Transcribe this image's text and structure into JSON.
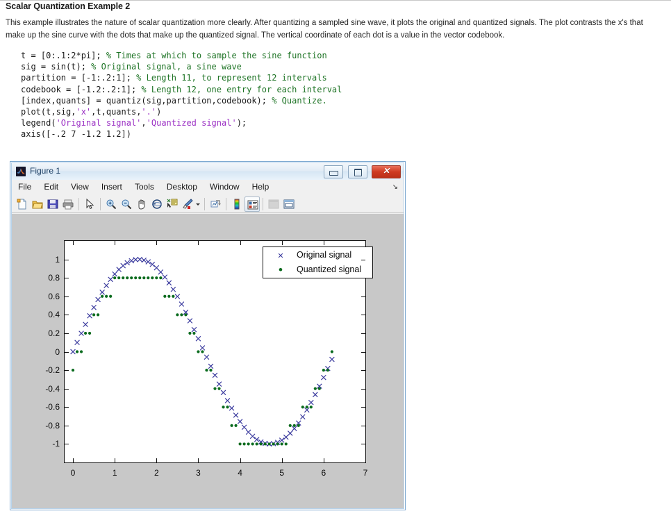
{
  "document": {
    "title": "Scalar Quantization Example 2",
    "paragraph": "This example illustrates the nature of scalar quantization more clearly. After quantizing a sampled sine wave, it plots the original and quantized signals. The plot contrasts the x's that make up the sine curve with the dots that make up the quantized signal. The vertical coordinate of each dot is a value in the vector codebook."
  },
  "code": {
    "lines": [
      {
        "code": "t = [0:.1:2*pi]; ",
        "comment": "% Times at which to sample the sine function"
      },
      {
        "code": "sig = sin(t); ",
        "comment": "% Original signal, a sine wave"
      },
      {
        "code": "partition = [-1:.2:1]; ",
        "comment": "% Length 11, to represent 12 intervals"
      },
      {
        "code": "codebook = [-1.2:.2:1]; ",
        "comment": "% Length 12, one entry for each interval"
      },
      {
        "code": "[index,quants] = quantiz(sig,partition,codebook); ",
        "comment": "% Quantize."
      },
      {
        "code": "plot(t,sig,",
        "str1": "'x'",
        "mid": ",t,quants,",
        "str2": "'.'",
        "tail": ")"
      },
      {
        "code": "legend(",
        "str1": "'Original signal'",
        "mid": ",",
        "str2": "'Quantized signal'",
        "tail": ");"
      },
      {
        "code": "axis([-.2 7 -1.2 1.2])",
        "comment": ""
      }
    ]
  },
  "figure_window": {
    "title": "Figure 1",
    "icon": "matlab-logo-icon",
    "window_controls": {
      "minimize": "minimize-button",
      "maximize": "maximize-button",
      "close": "close-button",
      "close_glyph": "✕"
    },
    "menu": [
      "File",
      "Edit",
      "View",
      "Insert",
      "Tools",
      "Desktop",
      "Window",
      "Help"
    ],
    "menu_overflow_glyph": "↘",
    "toolbar": [
      {
        "name": "new-figure-icon",
        "group": 0
      },
      {
        "name": "open-file-icon",
        "group": 0
      },
      {
        "name": "save-figure-icon",
        "group": 0
      },
      {
        "name": "print-figure-icon",
        "group": 0
      },
      {
        "name": "edit-plot-pointer-icon",
        "group": 1
      },
      {
        "name": "zoom-in-icon",
        "group": 2
      },
      {
        "name": "zoom-out-icon",
        "group": 2
      },
      {
        "name": "pan-hand-icon",
        "group": 2
      },
      {
        "name": "rotate-3d-icon",
        "group": 2
      },
      {
        "name": "data-cursor-icon",
        "group": 2
      },
      {
        "name": "brush-select-data-icon",
        "group": 2,
        "has_caret": true
      },
      {
        "name": "link-plot-icon",
        "group": 3
      },
      {
        "name": "colorbar-icon",
        "group": 4
      },
      {
        "name": "legend-toggle-icon",
        "group": 4,
        "pressed": true
      },
      {
        "name": "hide-plot-tools-icon",
        "group": 5,
        "disabled": true
      },
      {
        "name": "show-plot-tools-icon",
        "group": 5
      }
    ]
  },
  "chart_data": {
    "type": "scatter",
    "title": "",
    "xlabel": "",
    "ylabel": "",
    "xlim": [
      -0.2,
      7
    ],
    "ylim": [
      -1.2,
      1.2
    ],
    "xticks": [
      0,
      1,
      2,
      3,
      4,
      5,
      6,
      7
    ],
    "xticklabels": [
      "0",
      "1",
      "2",
      "3",
      "4",
      "5",
      "6",
      "7"
    ],
    "yticks": [
      1,
      0.8,
      0.6,
      0.4,
      0.2,
      0,
      -0.2,
      -0.4,
      -0.6,
      -0.8,
      -1
    ],
    "yticklabels": [
      "1",
      "0.8",
      "0.6",
      "0.4",
      "0.2",
      "0",
      "-0.2",
      "-0.4",
      "-0.6",
      "-0.8",
      "-1"
    ],
    "grid": false,
    "legend": {
      "position": "top-right-inside",
      "entries": [
        {
          "label": "Original signal",
          "marker": "x",
          "color": "#3b3b9e"
        },
        {
          "label": "Quantized signal",
          "marker": ".",
          "color": "#0a6b1e"
        }
      ]
    },
    "codebook": [
      -1.2,
      -1.0,
      -0.8,
      -0.6,
      -0.4,
      -0.2,
      0,
      0.2,
      0.4,
      0.6,
      0.8,
      1.0
    ],
    "partition": [
      -1,
      -0.8,
      -0.6,
      -0.4,
      -0.2,
      0,
      0.2,
      0.4,
      0.6,
      0.8,
      1
    ],
    "sample_step": 0.1,
    "series": [
      {
        "name": "Original signal",
        "marker": "x",
        "color": "#3b3b9e",
        "x": [
          0,
          0.1,
          0.2,
          0.3,
          0.4,
          0.5,
          0.6,
          0.7,
          0.8,
          0.9,
          1,
          1.1,
          1.2,
          1.3,
          1.4,
          1.5,
          1.6,
          1.7,
          1.8,
          1.9,
          2,
          2.1,
          2.2,
          2.3,
          2.4,
          2.5,
          2.6,
          2.7,
          2.8,
          2.9,
          3,
          3.1,
          3.2,
          3.3,
          3.4,
          3.5,
          3.6,
          3.7,
          3.8,
          3.9,
          4,
          4.1,
          4.2,
          4.3,
          4.4,
          4.5,
          4.6,
          4.7,
          4.8,
          4.9,
          5,
          5.1,
          5.2,
          5.3,
          5.4,
          5.5,
          5.6,
          5.7,
          5.8,
          5.9,
          6,
          6.1,
          6.2
        ],
        "y": [
          0,
          0.0998,
          0.1987,
          0.2955,
          0.3894,
          0.4794,
          0.5646,
          0.6442,
          0.7174,
          0.7833,
          0.8415,
          0.8912,
          0.932,
          0.9636,
          0.9854,
          0.9975,
          0.9996,
          0.9917,
          0.9738,
          0.9463,
          0.9093,
          0.8632,
          0.8085,
          0.7457,
          0.6755,
          0.5985,
          0.5155,
          0.4274,
          0.335,
          0.2392,
          0.1411,
          0.0416,
          -0.0584,
          -0.1577,
          -0.2555,
          -0.3508,
          -0.4425,
          -0.5298,
          -0.6119,
          -0.6878,
          -0.7568,
          -0.8183,
          -0.8716,
          -0.9162,
          -0.9516,
          -0.9775,
          -0.9937,
          -0.9999,
          -0.9962,
          -0.9825,
          -0.9589,
          -0.9258,
          -0.8835,
          -0.8323,
          -0.7728,
          -0.7055,
          -0.6313,
          -0.5507,
          -0.4646,
          -0.3739,
          -0.2794,
          -0.1822,
          -0.0831
        ]
      },
      {
        "name": "Quantized signal",
        "marker": ".",
        "color": "#0a6b1e",
        "x": [
          0,
          0.1,
          0.2,
          0.3,
          0.4,
          0.5,
          0.6,
          0.7,
          0.8,
          0.9,
          1,
          1.1,
          1.2,
          1.3,
          1.4,
          1.5,
          1.6,
          1.7,
          1.8,
          1.9,
          2,
          2.1,
          2.2,
          2.3,
          2.4,
          2.5,
          2.6,
          2.7,
          2.8,
          2.9,
          3,
          3.1,
          3.2,
          3.3,
          3.4,
          3.5,
          3.6,
          3.7,
          3.8,
          3.9,
          4,
          4.1,
          4.2,
          4.3,
          4.4,
          4.5,
          4.6,
          4.7,
          4.8,
          4.9,
          5,
          5.1,
          5.2,
          5.3,
          5.4,
          5.5,
          5.6,
          5.7,
          5.8,
          5.9,
          6,
          6.1,
          6.2
        ],
        "y": [
          -0.2,
          0,
          0,
          0.2,
          0.2,
          0.4,
          0.4,
          0.6,
          0.6,
          0.6,
          0.8,
          0.8,
          0.8,
          0.8,
          0.8,
          0.8,
          0.8,
          0.8,
          0.8,
          0.8,
          0.8,
          0.8,
          0.6,
          0.6,
          0.6,
          0.4,
          0.4,
          0.4,
          0.2,
          0.2,
          0,
          0,
          -0.2,
          -0.2,
          -0.4,
          -0.4,
          -0.6,
          -0.6,
          -0.8,
          -0.8,
          -1,
          -1,
          -1,
          -1,
          -1,
          -1,
          -1,
          -1,
          -1,
          -1,
          -1,
          -1,
          -0.8,
          -0.8,
          -0.8,
          -0.6,
          -0.6,
          -0.6,
          -0.4,
          -0.4,
          -0.2,
          -0.2,
          0
        ]
      }
    ]
  }
}
